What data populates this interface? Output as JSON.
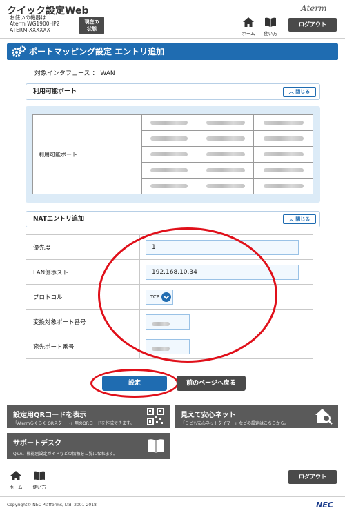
{
  "header": {
    "app_title": "クイック設定Web",
    "device_caption": "お使いの機器は",
    "device_model": "Aterm WG1900HP2",
    "device_id": "ATERM-XXXXXX",
    "status_button_line1": "現在の",
    "status_button_line2": "状態",
    "brand": "Aterm",
    "home_label": "ホーム",
    "help_label": "使い方",
    "logout_label": "ログアウト"
  },
  "page": {
    "title": "ポートマッピング設定 エントリ追加",
    "interface_label": "対象インタフェース",
    "interface_sep": "：",
    "interface_value": "WAN"
  },
  "available_ports": {
    "section_title": "利用可能ポート",
    "close_label": "閉じる",
    "row_label": "利用可能ポート"
  },
  "nat": {
    "section_title": "NATエントリ追加",
    "close_label": "閉じる",
    "fields": [
      {
        "label": "優先度",
        "value": "1"
      },
      {
        "label": "LAN側ホスト",
        "value": "192.168.10.34"
      },
      {
        "label": "プロトコル",
        "value": "TCP"
      },
      {
        "label": "変換対象ポート番号",
        "value": ""
      },
      {
        "label": "宛先ポート番号",
        "value": ""
      }
    ]
  },
  "actions": {
    "set_label": "設定",
    "back_label": "前のページへ戻る"
  },
  "tiles": [
    {
      "title": "設定用QRコードを表示",
      "desc": "「Atermらくらく QRスタート」用のQRコードを作成できます。"
    },
    {
      "title": "見えて安心ネット",
      "desc": "「こども安心ネットタイマー」などの設定はこちらから。"
    },
    {
      "title": "サポートデスク",
      "desc": "Q&A、機能別設定ガイドなどの情報をご覧になれます。"
    }
  ],
  "footer": {
    "home_label": "ホーム",
    "help_label": "使い方",
    "logout_label": "ログアウト",
    "copyright": "Copyright© NEC Platforms, Ltd. 2001-2018",
    "nec": "NEC"
  },
  "colors": {
    "accent_blue": "#1f6cb1",
    "panel_bg": "#dcebf7",
    "annotation_red": "#e0101a",
    "dark_button": "#4a4a4a"
  }
}
